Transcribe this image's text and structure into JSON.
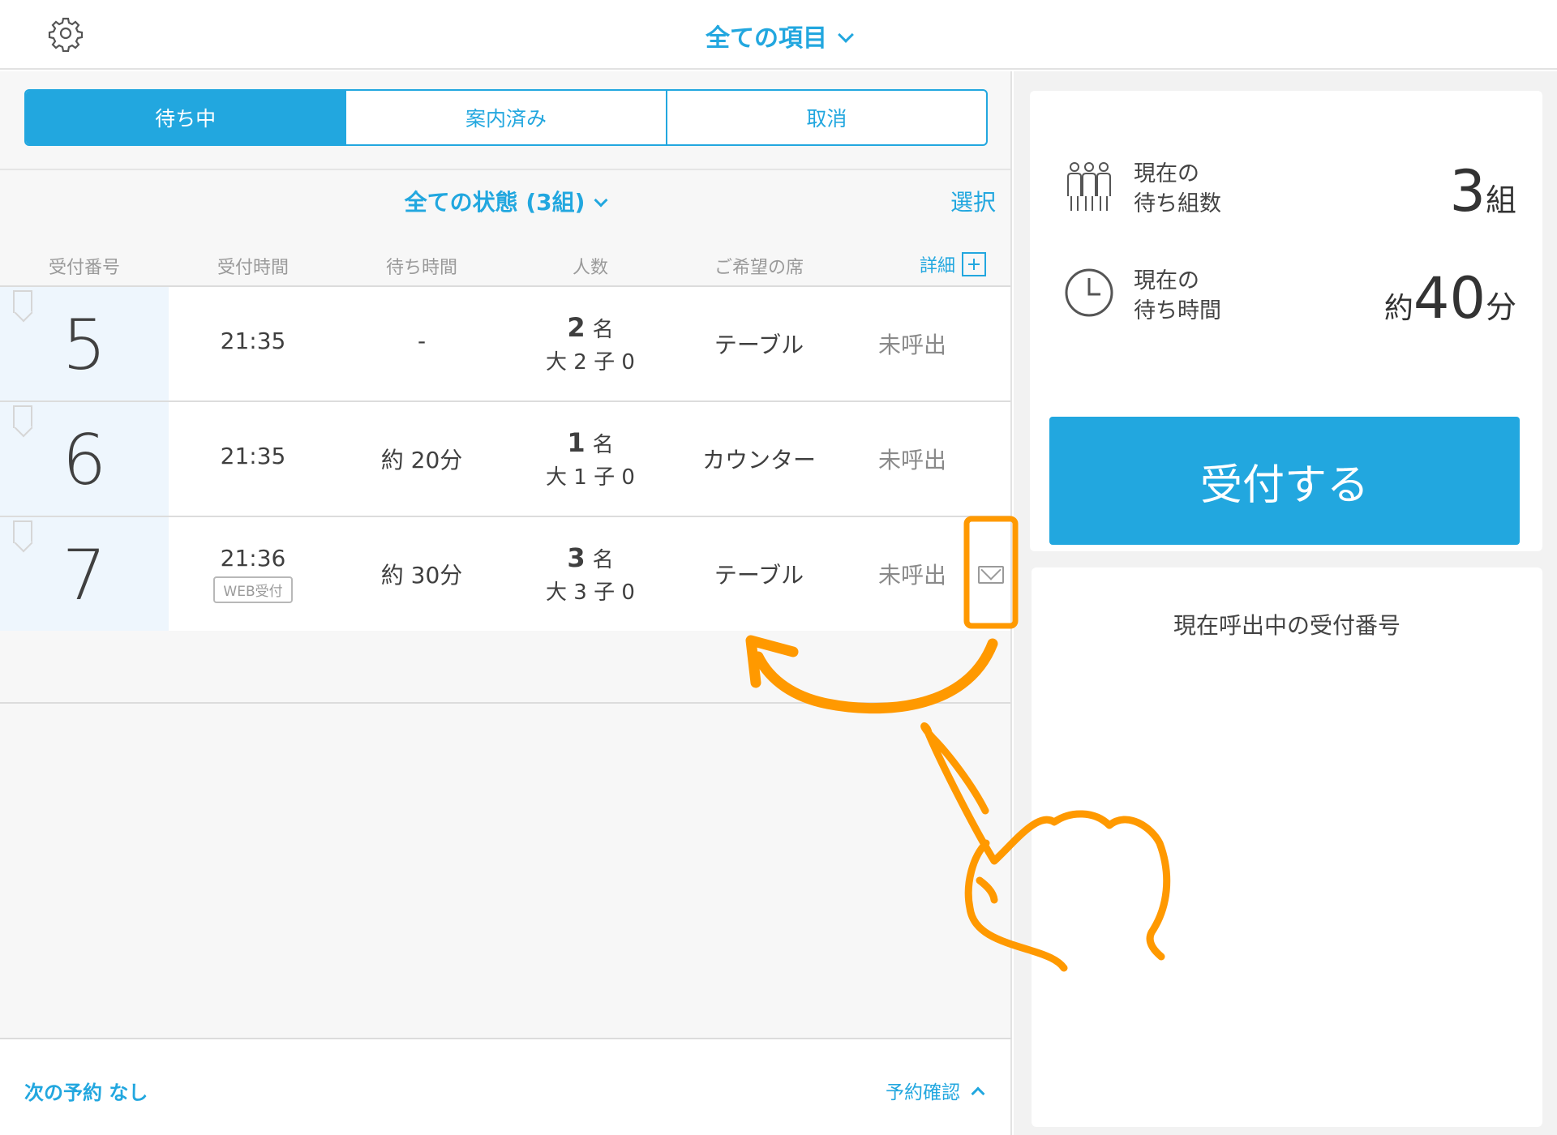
{
  "header": {
    "title": "全ての項目",
    "settings_icon": "gear-icon"
  },
  "tabs": [
    {
      "label": "待ち中",
      "active": true
    },
    {
      "label": "案内済み",
      "active": false
    },
    {
      "label": "取消",
      "active": false
    }
  ],
  "filter": {
    "label": "全ての状態 (3組)",
    "select_label": "選択"
  },
  "table": {
    "columns": [
      "受付番号",
      "受付時間",
      "待ち時間",
      "人数",
      "ご希望の席"
    ],
    "detail_label": "詳細",
    "rows": [
      {
        "number": "5",
        "time": "21:35",
        "wait": "-",
        "people_count": "2",
        "people_unit": "名",
        "breakdown": "大 2 子 0",
        "seat": "テーブル",
        "status": "未呼出"
      },
      {
        "number": "6",
        "time": "21:35",
        "wait": "約 20分",
        "people_count": "1",
        "people_unit": "名",
        "breakdown": "大 1 子 0",
        "seat": "カウンター",
        "status": "未呼出"
      },
      {
        "number": "7",
        "time": "21:36",
        "badge": "WEB受付",
        "wait": "約 30分",
        "people_count": "3",
        "people_unit": "名",
        "breakdown": "大 3 子 0",
        "seat": "テーブル",
        "status": "未呼出",
        "icon": "mail-icon"
      }
    ]
  },
  "footer": {
    "next_reservation": "次の予約 なし",
    "reservation_confirm": "予約確認"
  },
  "stats": {
    "groups_label_1": "現在の",
    "groups_label_2": "待ち組数",
    "groups_value": "3",
    "groups_unit": "組",
    "wait_label_1": "現在の",
    "wait_label_2": "待ち時間",
    "wait_prefix": "約",
    "wait_value": "40",
    "wait_unit": "分"
  },
  "receive_button": "受付する",
  "calling": {
    "title": "現在呼出中の受付番号"
  },
  "colors": {
    "accent": "#22a7df",
    "annotation": "#ff9900"
  }
}
